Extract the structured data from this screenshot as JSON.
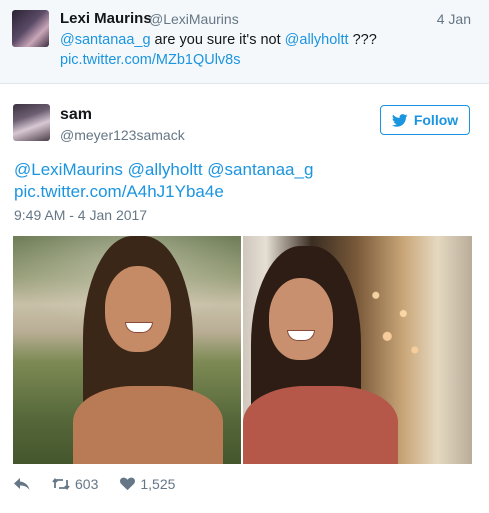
{
  "parent_tweet": {
    "name": "Lexi Maurins",
    "handle": "@LexiMaurins",
    "time": "4 Jan",
    "mention1": "@santanaa_g",
    "text_middle": " are you sure it's not ",
    "mention2": "@allyholtt",
    "text_end": " ???",
    "link": "pic.twitter.com/MZb1QUlv8s"
  },
  "tweet": {
    "name": "sam",
    "handle": "@meyer123samack",
    "follow_label": "Follow",
    "mention1": "@LexiMaurins",
    "mention2": "@allyholtt",
    "mention3": "@santanaa_g",
    "link": "pic.twitter.com/A4hJ1Yba4e",
    "timestamp": "9:49 AM - 4 Jan 2017",
    "retweets": "603",
    "likes": "1,525"
  },
  "icons": [
    "reply-icon",
    "retweet-icon",
    "heart-icon",
    "twitter-bird-icon"
  ],
  "colors": {
    "link": "#1b95e0",
    "muted": "#657786",
    "header_bg": "#f5f8fa"
  }
}
